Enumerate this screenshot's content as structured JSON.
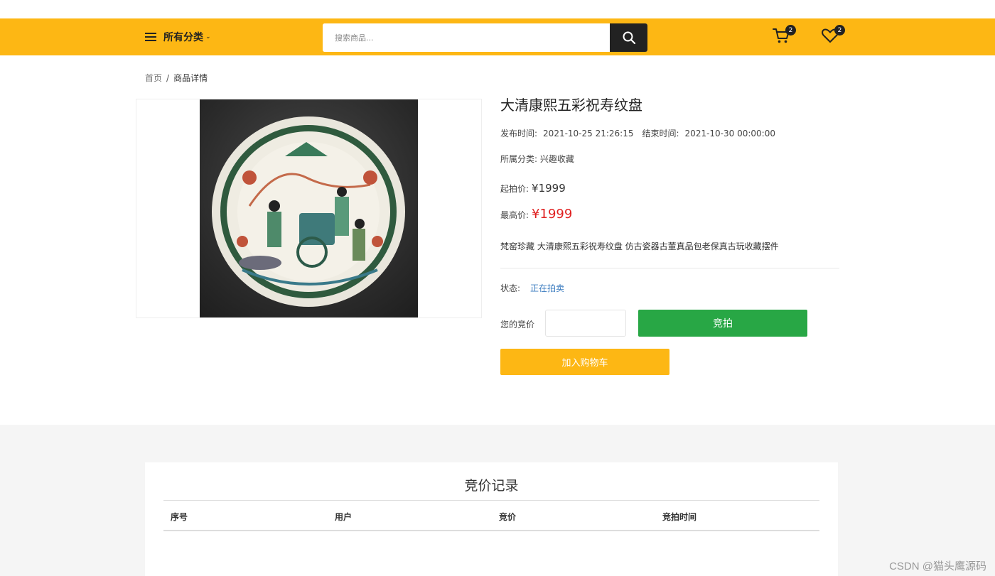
{
  "header": {
    "category_label": "所有分类",
    "search_placeholder": "搜索商品...",
    "cart_count": "2",
    "wishlist_count": "2"
  },
  "breadcrumb": {
    "home": "首页",
    "separator": "/",
    "current": "商品详情"
  },
  "product": {
    "title": "大清康熙五彩祝寿纹盘",
    "publish_label": "发布时间:",
    "publish_time": "2021-10-25 21:26:15",
    "end_label": "结束时间:",
    "end_time": "2021-10-30 00:00:00",
    "category_label": "所属分类:",
    "category_value": "兴趣收藏",
    "start_price_label": "起拍价:",
    "start_price": "¥1999",
    "max_price_label": "最高价:",
    "max_price": "¥1999",
    "description": "梵窑珍藏 大清康熙五彩祝寿纹盘 仿古瓷器古董真品包老保真古玩收藏摆件",
    "status_label": "状态:",
    "status_value": "正在拍卖",
    "your_bid_label": "您的竞价",
    "bid_button": "竞拍",
    "cart_button": "加入购物车"
  },
  "bid_records": {
    "title": "竞价记录",
    "columns": [
      "序号",
      "用户",
      "竞价",
      "竞拍时间"
    ]
  },
  "watermark": "CSDN @猫头鹰源码",
  "colors": {
    "brand": "#fdb714",
    "bid_green": "#28a745",
    "price_red": "#e02020",
    "status_blue": "#3a7bbf"
  }
}
